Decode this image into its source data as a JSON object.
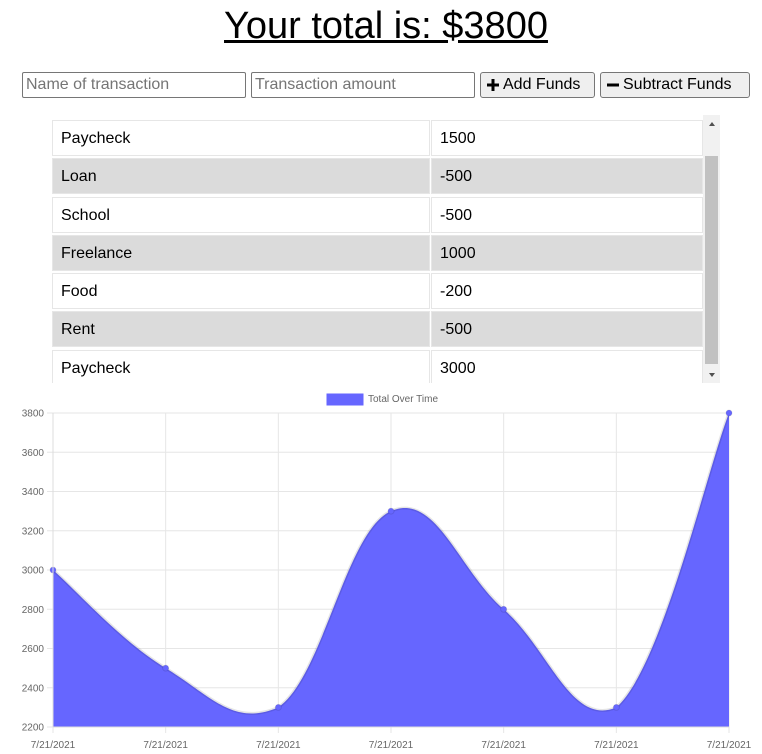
{
  "header": {
    "title": "Your total is: $3800"
  },
  "form": {
    "name_placeholder": "Name of transaction",
    "amount_placeholder": "Transaction amount",
    "name_value": "",
    "amount_value": "",
    "add_label": "Add Funds",
    "subtract_label": "Subtract Funds",
    "add_icon": "plus-icon",
    "subtract_icon": "minus-icon"
  },
  "transactions": [
    {
      "name": "Paycheck",
      "amount": "1500"
    },
    {
      "name": "Loan",
      "amount": "-500"
    },
    {
      "name": "School",
      "amount": "-500"
    },
    {
      "name": "Freelance",
      "amount": "1000"
    },
    {
      "name": "Food",
      "amount": "-200"
    },
    {
      "name": "Rent",
      "amount": "-500"
    },
    {
      "name": "Paycheck",
      "amount": "3000"
    }
  ],
  "colors": {
    "fill": "#6666ff",
    "row_alt": "#dbdbdb",
    "grid": "#e6e6e6",
    "tick_text": "#666666"
  },
  "chart_data": {
    "type": "area",
    "legend": "Total Over Time",
    "legend_position": "top",
    "x": [
      "7/21/2021",
      "7/21/2021",
      "7/21/2021",
      "7/21/2021",
      "7/21/2021",
      "7/21/2021",
      "7/21/2021"
    ],
    "series": [
      {
        "name": "Total Over Time",
        "values": [
          3000,
          2500,
          2300,
          3300,
          2800,
          2300,
          3800
        ]
      }
    ],
    "ylim": [
      2200,
      3800
    ],
    "yticks": [
      2200,
      2400,
      2600,
      2800,
      3000,
      3200,
      3400,
      3600,
      3800
    ],
    "grid": true,
    "smooth": true
  }
}
